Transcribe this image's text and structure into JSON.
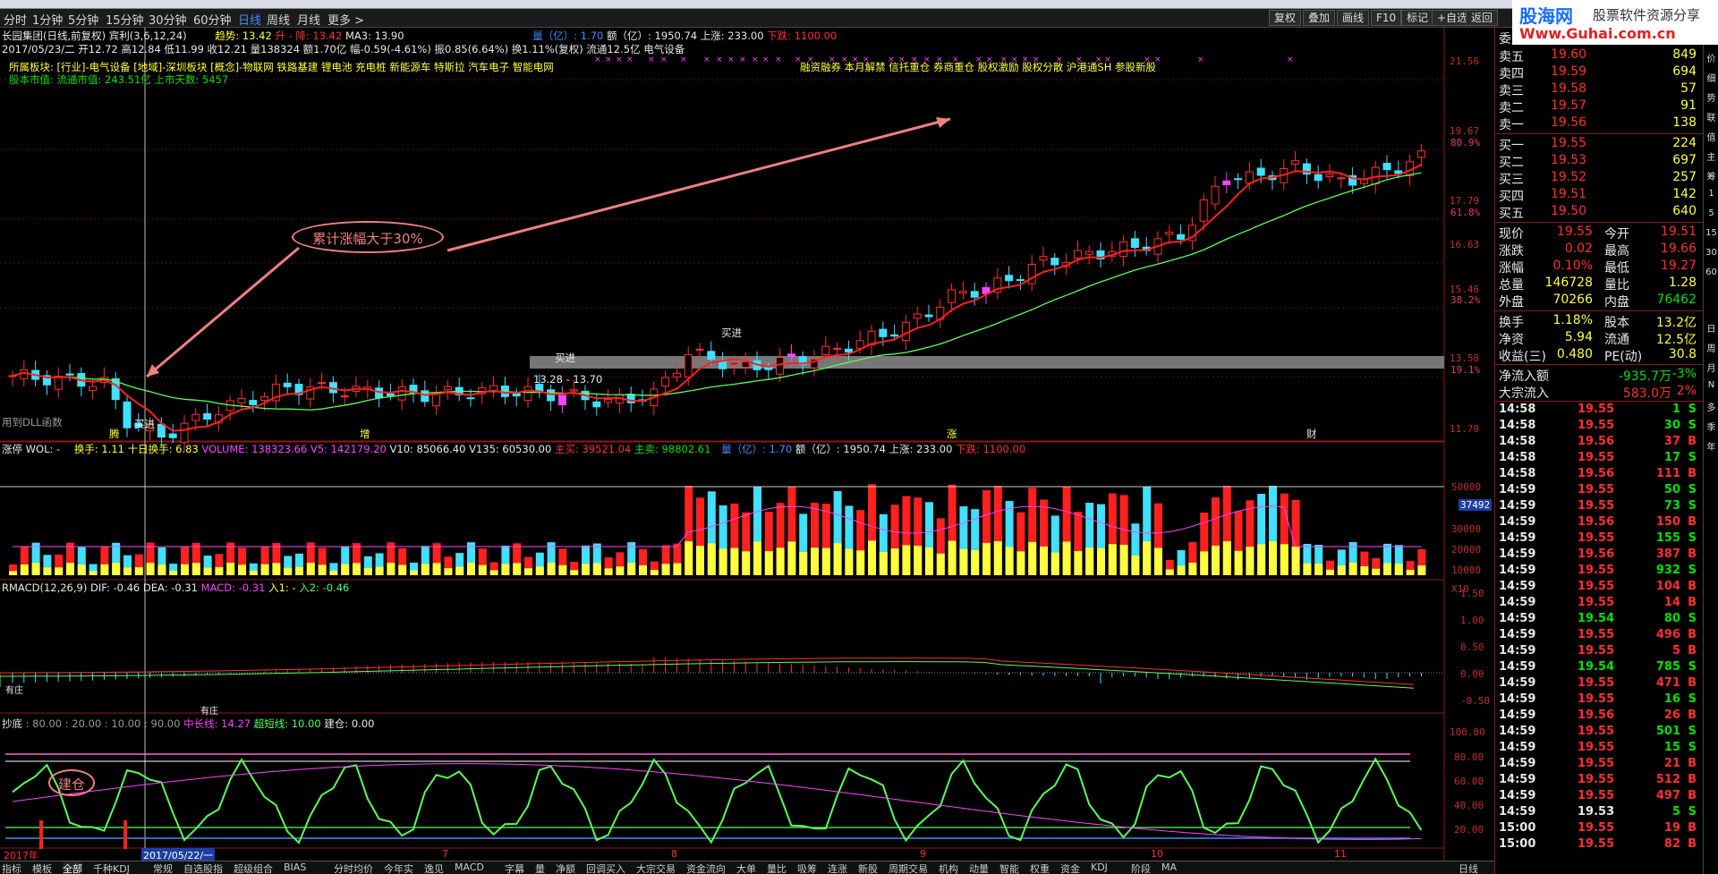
{
  "period_tabs": [
    {
      "label": "分时"
    },
    {
      "label": "1分钟"
    },
    {
      "label": "5分钟"
    },
    {
      "label": "15分钟"
    },
    {
      "label": "30分钟"
    },
    {
      "label": "60分钟"
    },
    {
      "label": "日线",
      "active": true
    },
    {
      "label": "周线"
    },
    {
      "label": "月线"
    },
    {
      "label": "更多 >"
    }
  ],
  "toolbar": [
    "复权",
    "叠加",
    "画线",
    "F10",
    "标记",
    "+自选",
    "返回"
  ],
  "watermark": {
    "line1": "股海网",
    "line1b": "股票软件资源分享",
    "line2": "Www.Guhai.com.cn"
  },
  "price_chart": {
    "title": "长园集团(日线,前复权)",
    "formula": "宾利(3,6,12,24)",
    "trend_label": "趋势: 13.42",
    "up_label": "升 - 降: 13.42",
    "ma3_label": "MA3: 13.90",
    "vol_label": "量（亿）: 1.70",
    "amount_label": "额（亿）: 1950.74",
    "up_count": "上涨: 233.00",
    "down_count": "下跌: 1100.00",
    "date_line": "2017/05/23/二 开12.72 高12.84 低11.99 收12.21 量138324 额1.70亿 幅-0.59(-4.61%) 振0.85(6.64%) 换1.11%(复权) 流通12.5亿 电气设备",
    "sector_line": "所属板块: [行业]-电气设备 [地域]-深圳板块 [概念]-物联网 铁路基建 锂电池 充电桩 新能源车 特斯拉 汽车电子 智能电网",
    "market_line": "股本市值: 流通市值: 243.51亿 上市天数: 5457",
    "concept_line": "融资融券 本月解禁 信托重仓 券商重仓 股权激励 股权分散 沪港通SH 参股新股",
    "annotation": "累计涨幅大于30%",
    "range_label": "13.28 - 13.70",
    "buy_label": "买进",
    "dll_label": "用到DLL函数",
    "marker_labels": [
      "腾",
      "增",
      "涨",
      "财"
    ],
    "y_labels": [
      "21.56",
      "19.67",
      "17.79",
      "16.63",
      "15.46",
      "13.58",
      "11.70"
    ],
    "pct_labels": [
      "80.9%",
      "61.8%",
      "38.2%",
      "19.1%"
    ]
  },
  "volume_panel": {
    "label": "涨停 WOL: -",
    "turnover": "换手: 1.11",
    "ten_day": "十日换手: 6.83",
    "volume": "VOLUME: 138323.66",
    "v5": "V5: 142179.20",
    "v10": "V10: 85066.40",
    "v135": "V135: 60530.00",
    "main_sell": "主买: 39521.04",
    "main_buy": "主卖: 98802.61",
    "vol2": "量（亿）: 1.70",
    "amount": "额（亿）: 1950.74",
    "up": "上涨: 233.00",
    "down": "下跌: 1100.00",
    "y_labels": [
      "50000",
      "40000",
      "30000",
      "20000",
      "10000"
    ],
    "cursor_value": "37492",
    "multiplier": "X10"
  },
  "macd_panel": {
    "label": "RMACD(12,26,9)",
    "dif": "DIF: -0.46",
    "dea": "DEA: -0.31",
    "macd": "MACD: -0.31",
    "in1": "入1: -",
    "in2": "入2: -0.46",
    "y_labels": [
      "1.50",
      "1.00",
      "0.50",
      "0.00",
      "-0.50"
    ],
    "marks": [
      "有庄",
      "有庄"
    ]
  },
  "bottom_panel": {
    "label": "抄底",
    "values": ": 80.00 : 20.00 : 10.00 : 90.00",
    "mid": "中长线: 14.27",
    "short": "超短线: 10.00",
    "build": "建仓: 0.00",
    "annotation": "建仓",
    "y_labels": [
      "100.00",
      "80.00",
      "60.00",
      "40.00",
      "20.00"
    ],
    "date_labels": [
      "2017年",
      "2017/05/22/一",
      "7",
      "8",
      "9",
      "10",
      "11"
    ]
  },
  "orderbook": {
    "header": "委比",
    "asks": [
      {
        "name": "卖五",
        "price": "19.60",
        "vol": "849"
      },
      {
        "name": "卖四",
        "price": "19.59",
        "vol": "694"
      },
      {
        "name": "卖三",
        "price": "19.58",
        "vol": "57"
      },
      {
        "name": "卖二",
        "price": "19.57",
        "vol": "91"
      },
      {
        "name": "卖一",
        "price": "19.56",
        "vol": "138"
      }
    ],
    "bids": [
      {
        "name": "买一",
        "price": "19.55",
        "vol": "224"
      },
      {
        "name": "买二",
        "price": "19.53",
        "vol": "697"
      },
      {
        "name": "买三",
        "price": "19.52",
        "vol": "257"
      },
      {
        "name": "买四",
        "price": "19.51",
        "vol": "142"
      },
      {
        "name": "买五",
        "price": "19.50",
        "vol": "640"
      }
    ],
    "quote": [
      {
        "l": "现价",
        "lv": "19.55",
        "r": "今开",
        "rv": "19.51"
      },
      {
        "l": "涨跌",
        "lv": "0.02",
        "r": "最高",
        "rv": "19.66"
      },
      {
        "l": "涨幅",
        "lv": "0.10%",
        "r": "最低",
        "rv": "19.27"
      },
      {
        "l": "总量",
        "lv": "146728",
        "r": "量比",
        "rv": "1.28"
      },
      {
        "l": "外盘",
        "lv": "70266",
        "r": "内盘",
        "rv": "76462"
      }
    ],
    "stats": [
      {
        "l": "换手",
        "lv": "1.18%",
        "r": "股本",
        "rv": "13.2亿"
      },
      {
        "l": "净资",
        "lv": "5.94",
        "r": "流通",
        "rv": "12.5亿"
      },
      {
        "l": "收益(三)",
        "lv": "0.480",
        "r": "PE(动)",
        "rv": "30.8"
      }
    ],
    "flow": [
      {
        "l": "净流入额",
        "v": "-935.7万",
        "p": "-3%"
      },
      {
        "l": "大宗流入",
        "v": "583.0万",
        "p": "2%"
      }
    ],
    "ticks": [
      [
        "14:58",
        "19.55",
        "1",
        "S"
      ],
      [
        "14:58",
        "19.55",
        "30",
        "S"
      ],
      [
        "14:58",
        "19.56",
        "37",
        "B"
      ],
      [
        "14:58",
        "19.55",
        "17",
        "S"
      ],
      [
        "14:58",
        "19.56",
        "111",
        "B"
      ],
      [
        "14:59",
        "19.55",
        "50",
        "S"
      ],
      [
        "14:59",
        "19.55",
        "73",
        "S"
      ],
      [
        "14:59",
        "19.56",
        "150",
        "B"
      ],
      [
        "14:59",
        "19.55",
        "155",
        "S"
      ],
      [
        "14:59",
        "19.56",
        "387",
        "B"
      ],
      [
        "14:59",
        "19.55",
        "932",
        "S"
      ],
      [
        "14:59",
        "19.55",
        "104",
        "B"
      ],
      [
        "14:59",
        "19.55",
        "14",
        "B"
      ],
      [
        "14:59",
        "19.54",
        "80",
        "S"
      ],
      [
        "14:59",
        "19.55",
        "496",
        "B"
      ],
      [
        "14:59",
        "19.55",
        "5",
        "B"
      ],
      [
        "14:59",
        "19.54",
        "785",
        "S"
      ],
      [
        "14:59",
        "19.55",
        "471",
        "B"
      ],
      [
        "14:59",
        "19.55",
        "16",
        "S"
      ],
      [
        "14:59",
        "19.56",
        "26",
        "B"
      ],
      [
        "14:59",
        "19.55",
        "501",
        "S"
      ],
      [
        "14:59",
        "19.55",
        "15",
        "S"
      ],
      [
        "14:59",
        "19.55",
        "21",
        "B"
      ],
      [
        "14:59",
        "19.55",
        "512",
        "B"
      ],
      [
        "14:59",
        "19.55",
        "497",
        "B"
      ],
      [
        "14:59",
        "19.53",
        "5",
        "S"
      ],
      [
        "15:00",
        "19.55",
        "19",
        "B"
      ],
      [
        "15:00",
        "19.55",
        "82",
        "B"
      ]
    ]
  },
  "right_strip": [
    "笔",
    "价",
    "细",
    "势",
    "联",
    "值",
    "主",
    "筹",
    "1",
    "5",
    "15",
    "30",
    "60",
    "日",
    "周",
    "月",
    "N",
    "多",
    "季",
    "年"
  ],
  "bottom_tabs": [
    "指标",
    "模板",
    "全部",
    "千种KDJ",
    "常规",
    "自选股指",
    "超级组合",
    "BIAS",
    "分时均价",
    "今年实",
    "逸见",
    "MACD",
    "字幕",
    "量",
    "净额",
    "回调买入",
    "大宗交易",
    "资金流向",
    "大单",
    "量比",
    "吸筹",
    "连涨",
    "新股",
    "周期交易",
    "机构",
    "动量",
    "智能",
    "权重",
    "资金",
    "KDJ",
    "阶段",
    "MA"
  ],
  "bottom_right": "日线"
}
